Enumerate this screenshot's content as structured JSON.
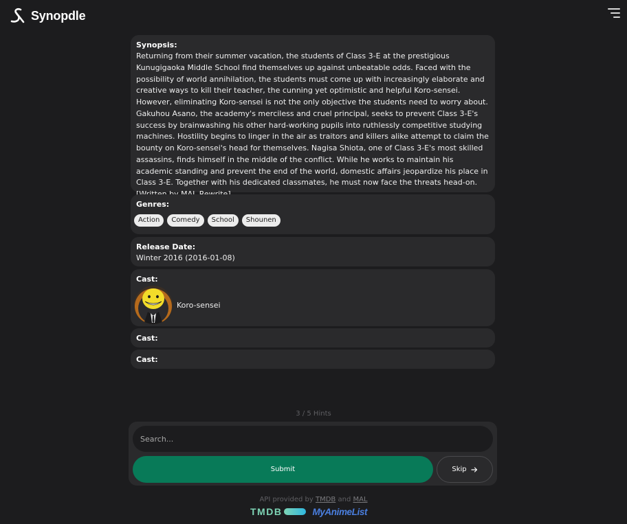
{
  "app": {
    "name": "Synopdle"
  },
  "synopsis": {
    "label": "Synopsis:",
    "text": "Returning from their summer vacation, the students of Class 3-E at the prestigious Kunugigaoka Middle School find themselves up against unbeatable odds. Faced with the possibility of world annihilation, the students must come up with increasingly elaborate and creative ways to kill their teacher, the cunning yet optimistic and helpful Koro-sensei. However, eliminating Koro-sensei is not the only objective the students need to worry about. Gakuhou Asano, the academy's merciless and cruel principal, seeks to prevent Class 3-E's success by brainwashing his other hard-working pupils into ruthlessly competitive studying machines. Hostility begins to linger in the air as traitors and killers alike attempt to claim the bounty on Koro-sensei's head for themselves. Nagisa Shiota, one of Class 3-E's most skilled assassins, finds himself in the middle of the conflict. While he works to maintain his academic standing and prevent the end of the world, domestic affairs jeopardize his place in Class 3-E. Together with his dedicated classmates, he must now face the threats head-on.",
    "credit": "[Written by MAL Rewrite]"
  },
  "genres": {
    "label": "Genres:",
    "items": [
      "Action",
      "Comedy",
      "School",
      "Shounen"
    ]
  },
  "release": {
    "label": "Release Date:",
    "value": "Winter 2016 (2016-01-08)"
  },
  "cast": [
    {
      "label": "Cast:",
      "name": "Koro-sensei"
    },
    {
      "label": "Cast:"
    },
    {
      "label": "Cast:"
    }
  ],
  "hints": {
    "text": "3 / 5 Hints"
  },
  "search": {
    "placeholder": "Search...",
    "value": ""
  },
  "buttons": {
    "submit": "Submit",
    "skip": "Skip",
    "skip_icon": "arrow-right-icon"
  },
  "footer": {
    "prefix": "API provided by",
    "tmdb_link": "TMDB",
    "conjunction": "and",
    "mal_link": "MAL",
    "tmdb_logo": "TMDB",
    "mal_logo": "MyAnimeList"
  },
  "colors": {
    "background": "#1c1c1e",
    "card": "#2a2a2c",
    "submit": "#087a58",
    "tmdb": "#7ed4b5",
    "mal": "#4a7fe0"
  }
}
